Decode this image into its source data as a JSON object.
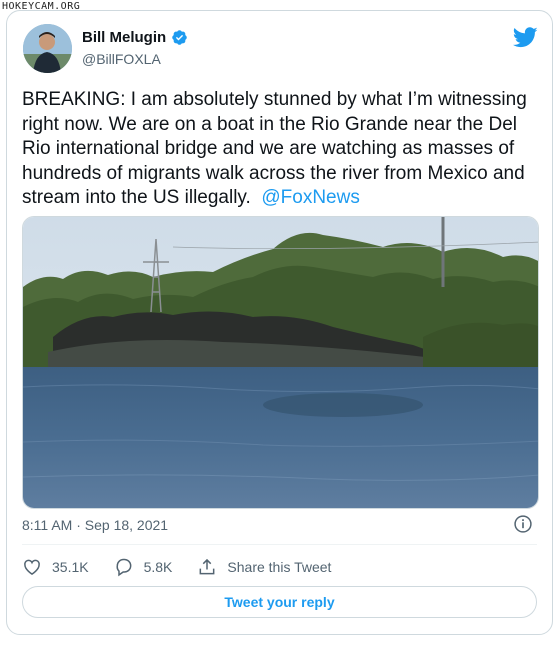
{
  "watermark": "HOKEYCAM.ORG",
  "author": {
    "name": "Bill Melugin",
    "handle": "@BillFOXLA"
  },
  "tweet": {
    "text": "BREAKING: I am absolutely stunned by what I’m witnessing right now. We are on a boat in the Rio Grande near the Del Rio international bridge and we are watching as masses of hundreds of migrants walk across the river from Mexico and stream into the US illegally.",
    "mention": "@FoxNews",
    "timestamp": "8:11 AM · Sep 18, 2021"
  },
  "actions": {
    "likes": "35.1K",
    "replies": "5.8K",
    "share_label": "Share this Tweet"
  },
  "reply_button": "Tweet your reply",
  "colors": {
    "accent": "#1d9bf0",
    "text": "#0f1419",
    "muted": "#536471",
    "border": "#cfd9de"
  },
  "icons": {
    "brand": "twitter-bird-icon",
    "verified": "verified-badge-icon",
    "info": "info-icon",
    "like": "heart-icon",
    "reply": "reply-bubble-icon",
    "share": "share-icon"
  }
}
